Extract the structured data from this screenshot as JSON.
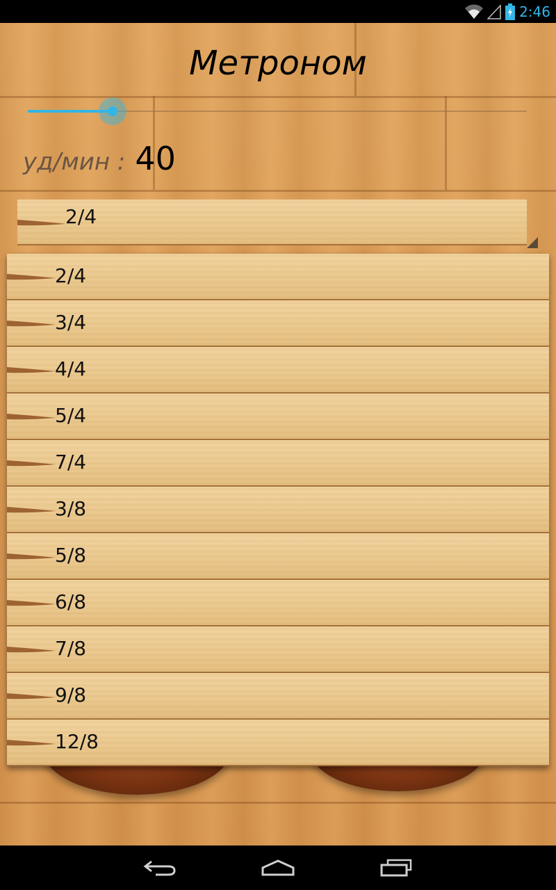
{
  "status_bar": {
    "time": "2:46",
    "icons": [
      "wifi-icon",
      "signal-icon",
      "battery-charging-icon"
    ]
  },
  "app": {
    "title": "Метроном",
    "tempo_slider": {
      "value_fraction": 0.17
    },
    "bpm": {
      "label": "уд/мин :",
      "value": "40"
    },
    "time_signature": {
      "selected": "2/4",
      "options": [
        "2/4",
        "3/4",
        "4/4",
        "5/4",
        "7/4",
        "3/8",
        "5/8",
        "6/8",
        "7/8",
        "9/8",
        "12/8"
      ]
    }
  },
  "nav_bar": {
    "buttons": [
      "back-icon",
      "home-icon",
      "recent-apps-icon"
    ]
  },
  "colors": {
    "accent": "#33b5e5",
    "wood": "#dc9c55",
    "plank": "#eccb92"
  }
}
